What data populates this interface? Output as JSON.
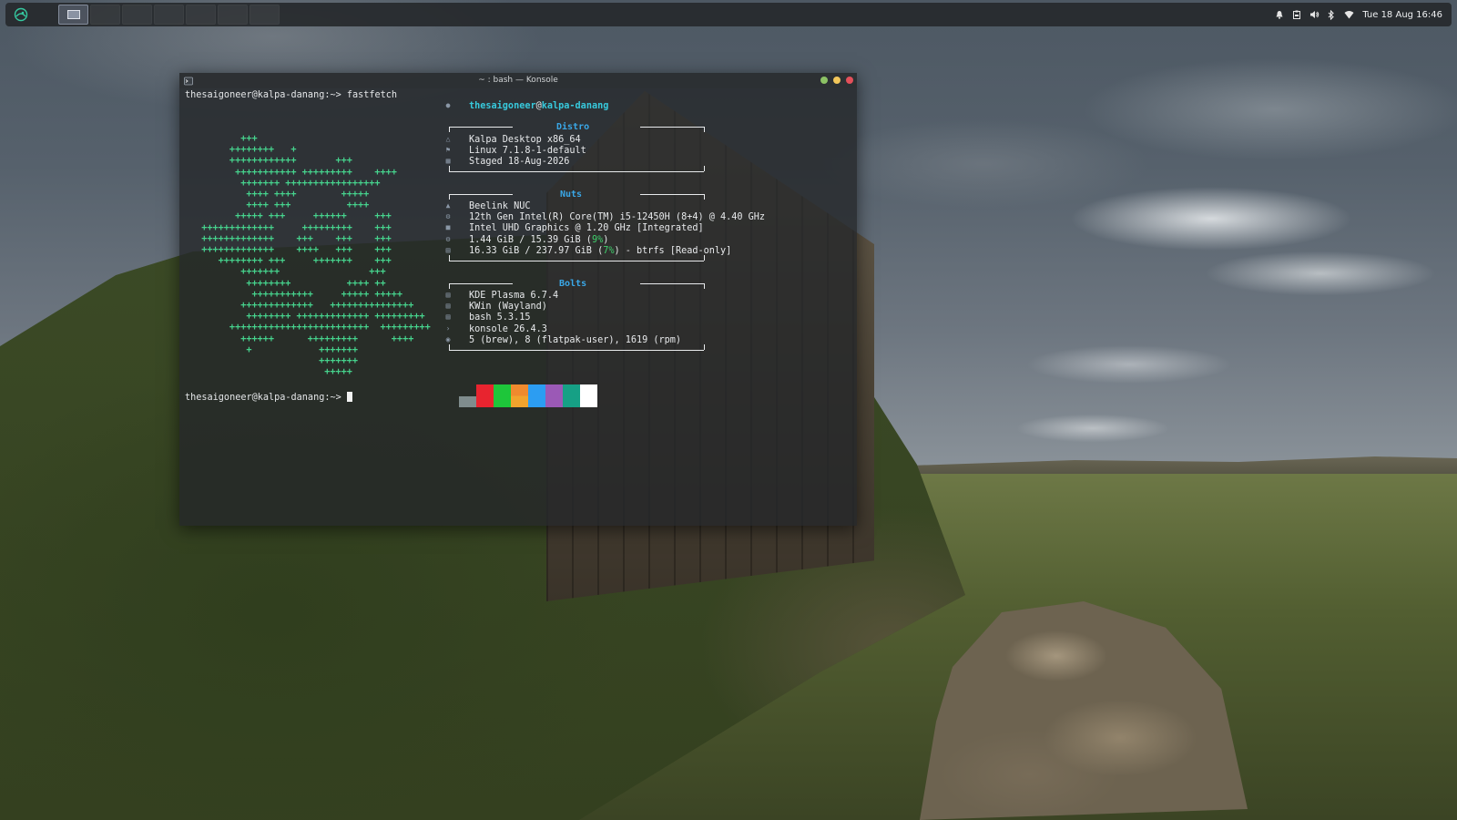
{
  "panel": {
    "clock": "Tue 18 Aug 16:46",
    "workspaces": [
      {
        "active": true
      },
      {
        "active": false
      },
      {
        "active": false
      },
      {
        "active": false
      },
      {
        "active": false
      },
      {
        "active": false
      },
      {
        "active": false
      }
    ],
    "tray_icons": [
      "notifications-icon",
      "clipboard-icon",
      "volume-icon",
      "bluetooth-icon",
      "network-icon"
    ]
  },
  "window": {
    "title": "~ : bash — Konsole"
  },
  "terminal": {
    "prompt1": "thesaigoneer@kalpa-danang:~> fastfetch",
    "prompt2": "thesaigoneer@kalpa-danang:~> ",
    "user": "thesaigoneer",
    "at": "@",
    "host": "kalpa-danang",
    "ascii_logo": [
      "         +++",
      "       ++++++++   +",
      "       ++++++++++++       +++",
      "        +++++++++++ +++++++++    ++++",
      "         +++++++ +++++++++++++++++",
      "          ++++ ++++        +++++",
      "          ++++ +++          ++++",
      "        +++++ +++     ++++++     +++",
      "  +++++++++++++     +++++++++    +++",
      "  +++++++++++++    +++    +++    +++",
      "  +++++++++++++    ++++   +++    +++",
      "     ++++++++ +++     +++++++    +++",
      "         +++++++                +++",
      "          ++++++++          ++++ ++",
      "           +++++++++++     +++++ +++++",
      "         +++++++++++++   +++++++++++++++",
      "          ++++++++ +++++++++++++ +++++++++",
      "       +++++++++++++++++++++++++  +++++++++",
      "         ++++++      +++++++++      ++++",
      "          +            +++++++",
      "                       +++++++",
      "                        +++++"
    ],
    "sections": {
      "distro": {
        "title": "Distro",
        "rows": [
          {
            "icon": "os-icon",
            "text": "Kalpa Desktop x86_64"
          },
          {
            "icon": "kernel-icon",
            "text": "Linux 7.1.8-1-default"
          },
          {
            "icon": "calendar-icon",
            "text": "Staged 18-Aug-2026"
          }
        ]
      },
      "nuts": {
        "title": "Nuts",
        "rows": [
          {
            "icon": "host-icon",
            "text": "Beelink NUC"
          },
          {
            "icon": "cpu-icon",
            "text": "12th Gen Intel(R) Core(TM) i5-12450H (8+4) @ 4.40 GHz"
          },
          {
            "icon": "gpu-icon",
            "text": "Intel UHD Graphics @ 1.20 GHz [Integrated]"
          }
        ],
        "memory": {
          "icon": "memory-icon",
          "pre": "1.44 GiB / 15.39 GiB (",
          "pct": "9%",
          "post": ")"
        },
        "disk": {
          "icon": "disk-icon",
          "pre": "16.33 GiB / 237.97 GiB (",
          "pct": "7%",
          "post": ") - btrfs [Read-only]"
        }
      },
      "bolts": {
        "title": "Bolts",
        "rows": [
          {
            "icon": "desktop-env-icon",
            "text": "KDE Plasma 6.7.4"
          },
          {
            "icon": "window-manager-icon",
            "text": "KWin (Wayland)"
          },
          {
            "icon": "shell-icon",
            "text": "bash 5.3.15"
          },
          {
            "icon": "terminal-icon",
            "text": "konsole 26.4.3"
          },
          {
            "icon": "packages-icon",
            "text": "5 (brew), 8 (flatpak-user), 1619 (rpm)"
          }
        ]
      }
    },
    "palette": [
      "#7f8c8d",
      "#e8242f",
      "#1ec63a",
      "#f2a32d",
      "#2c9df2",
      "#9b59b6",
      "#16a085",
      "#ffffff"
    ],
    "palette_top": [
      "#e8242f",
      "#1ec63a",
      "#f08a2e",
      "#2c9df2",
      "#9b59b6",
      "#16a085",
      "#ffffff"
    ]
  }
}
